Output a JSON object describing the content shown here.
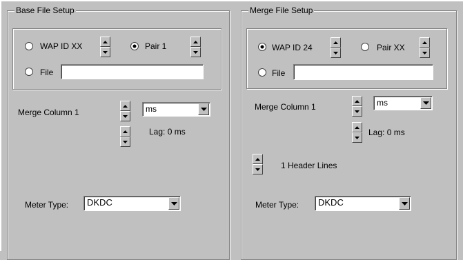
{
  "base": {
    "title": "Base File Setup",
    "wap_label": "WAP ID XX",
    "pair_label": "Pair 1",
    "file_label": "File",
    "file_value": "",
    "merge_column_label": "Merge Column  1",
    "unit_value": "ms",
    "lag_label": "Lag:  0 ms",
    "meter_type_label": "Meter Type:",
    "meter_type_value": "DKDC"
  },
  "merge": {
    "title": "Merge File Setup",
    "wap_label": "WAP ID 24",
    "pair_label": "Pair XX",
    "file_label": "File",
    "file_value": "",
    "merge_column_label": "Merge Column  1",
    "unit_value": "ms",
    "lag_label": "Lag:  0 ms",
    "header_lines_label": "1 Header Lines",
    "meter_type_label": "Meter Type:",
    "meter_type_value": "DKDC"
  }
}
